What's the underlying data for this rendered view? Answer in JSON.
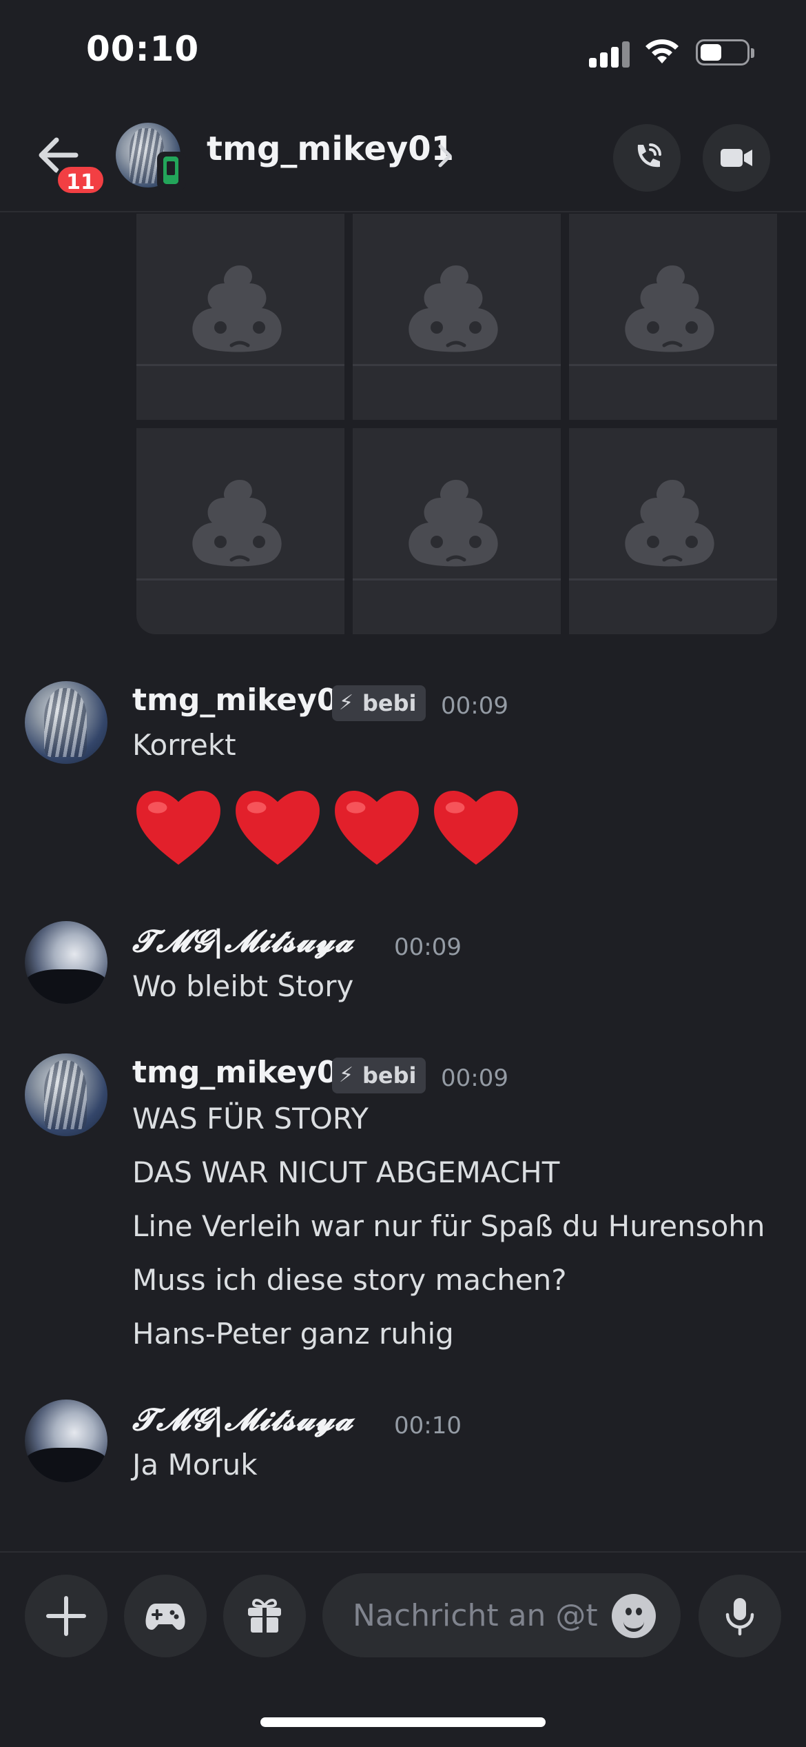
{
  "status_bar": {
    "time": "00:10"
  },
  "header": {
    "unread_count": "11",
    "title": "tmg_mikey01",
    "chevron": "›"
  },
  "composer": {
    "placeholder": "Nachricht an @t..."
  },
  "messages": [
    {
      "author": "tmg_mikey01",
      "tag": "bebi",
      "time": "00:09",
      "lines": [
        "Korrekt"
      ],
      "emoji": "❤️❤️❤️❤️"
    },
    {
      "author": "𝓣𝓜𝓖|𝓜𝓲𝓽𝓼𝓾𝔂𝓪",
      "time": "00:09",
      "lines": [
        "Wo bleibt Story"
      ]
    },
    {
      "author": "tmg_mikey01",
      "tag": "bebi",
      "time": "00:09",
      "lines": [
        "WAS FÜR STORY",
        "DAS WAR NICUT ABGEMACHT",
        "Line Verleih war nur für Spaß du Hurensohn",
        "Muss ich diese story machen?",
        "Hans-Peter ganz ruhig"
      ]
    },
    {
      "author": "𝓣𝓜𝓖|𝓜𝓲𝓽𝓼𝓾𝔂𝓪",
      "time": "00:10",
      "lines": [
        "Ja Moruk"
      ]
    }
  ],
  "icons": {
    "status": [
      "signal-icon",
      "wifi-icon",
      "battery-icon"
    ],
    "header": [
      "back-arrow-icon",
      "phone-call-icon",
      "video-camera-icon",
      "mobile-status-icon"
    ],
    "composer": [
      "plus-icon",
      "gamepad-icon",
      "gift-icon",
      "emoji-icon",
      "microphone-icon"
    ],
    "attachments": "broken-image-poop-icon"
  }
}
